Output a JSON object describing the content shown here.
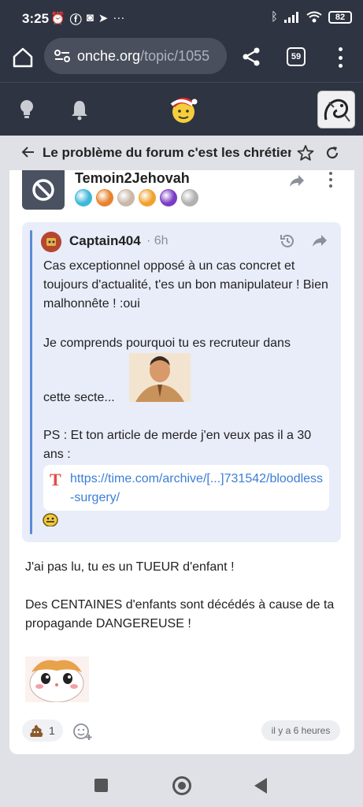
{
  "status_bar": {
    "time": "3:25",
    "battery": "82"
  },
  "browser": {
    "url_host": "onche.org",
    "url_path": "/topic/1055",
    "tab_count": "59"
  },
  "topic": {
    "title": "Le problème du forum c'est les chrétien"
  },
  "post": {
    "author": "Temoin2Jehovah",
    "badges": [
      "#3fb8d8",
      "#e7832f",
      "#c9b7a8",
      "#f0a22f",
      "#7b3cc4",
      "#b0b0b0"
    ],
    "quote": {
      "author": "Captain404",
      "time_sep": "·",
      "time": "6h",
      "p1": "Cas exceptionnel opposé à un cas concret et toujours d'actualité, t'es un bon manipulateur ! Bien malhonnête ! :oui",
      "p2": "Je comprends pourquoi tu es recruteur dans",
      "p2b": "cette secte...",
      "p3": "PS : Et ton article de merde j'en veux pas il a 30 ans :",
      "link_icon": "T",
      "link": "https://time.com/archive/[...]731542/bloodless-surgery/"
    },
    "reply_1": "J'ai pas lu, tu es un TUEUR d'enfant !",
    "reply_2": "Des CENTAINES d'enfants sont décédés à cause de ta propagande DANGEREUSE !",
    "reaction_count": "1",
    "timestamp": "il y a 6 heures"
  },
  "colors": {
    "chrome": "#2f3442",
    "quote_bg": "#e8edf9",
    "quote_bar": "#5c8ad8",
    "link": "#3b7ed6"
  }
}
